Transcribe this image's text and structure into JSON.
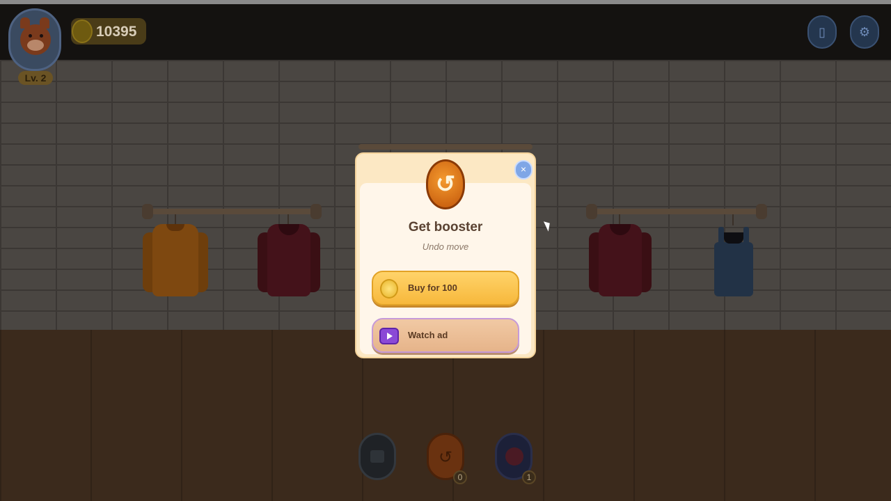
{
  "hud": {
    "level_label": "Lv. 2",
    "coins": "10395",
    "icons": [
      "avatar-fox",
      "coin-icon",
      "phone-icon",
      "settings-gear-icon"
    ]
  },
  "boosters": {
    "undo_count": "0",
    "magic_count": "1"
  },
  "dialog": {
    "title": "Get booster",
    "subtitle": "Undo move",
    "buy_label": "Buy for 100",
    "watch_label": "Watch ad",
    "close_label": "×"
  },
  "colors": {
    "dialog_bg": "#fff6ea",
    "buy_button": "#f7b83c",
    "watch_button": "#e6b48a",
    "close_button": "#7fa6e6",
    "booster_orange": "#e07418"
  }
}
